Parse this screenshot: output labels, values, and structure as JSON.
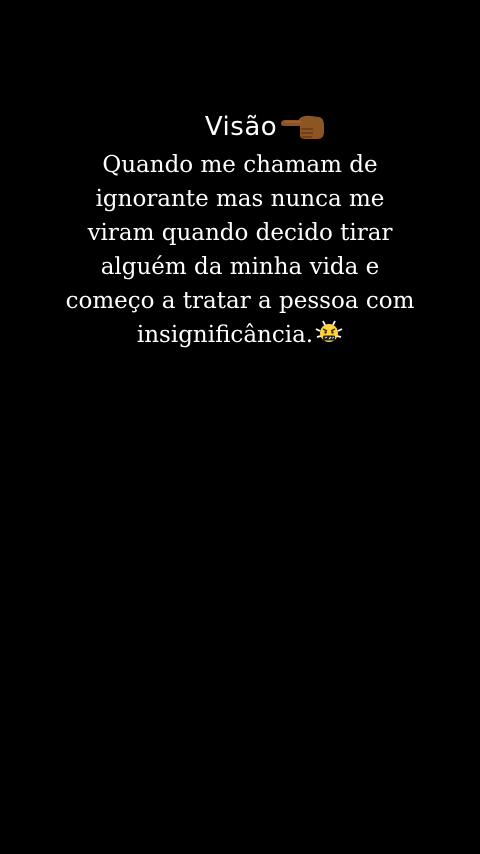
{
  "heading": {
    "text": "Visão",
    "icon": "backhand-index-pointing-left-icon"
  },
  "message": {
    "lines": [
      "Quando me chamam de",
      "ignorante mas nunca me",
      "viram quando decido tirar",
      "alguém da minha vida e",
      "começo a tratar a pessoa com",
      "insignificância."
    ],
    "end_icon": "angry-face-with-symbols-icon"
  },
  "colors": {
    "background": "#000000",
    "text": "#ffffff",
    "hand_skin": "#8d5524",
    "emoji_face": "#ffd23f"
  }
}
